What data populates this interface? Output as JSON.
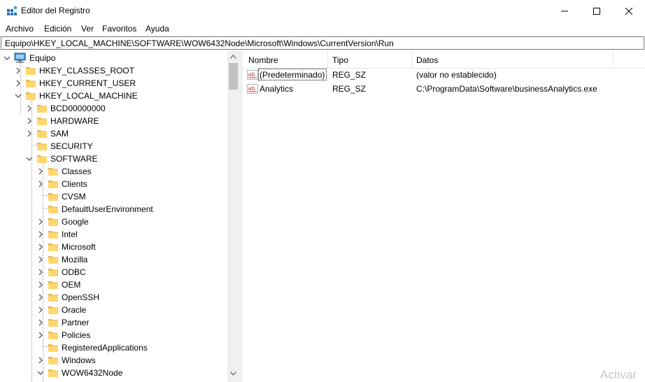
{
  "window": {
    "title": "Editor del Registro",
    "icon": "registry-editor-icon"
  },
  "menu": {
    "items": [
      "Archivo",
      "Edición",
      "Ver",
      "Favoritos",
      "Ayuda"
    ]
  },
  "address": {
    "path": "Equipo\\HKEY_LOCAL_MACHINE\\SOFTWARE\\WOW6432Node\\Microsoft\\Windows\\CurrentVersion\\Run"
  },
  "tree": {
    "root": "Equipo",
    "nodes": [
      {
        "label": "HKEY_CLASSES_ROOT",
        "state": "collapsed"
      },
      {
        "label": "HKEY_CURRENT_USER",
        "state": "collapsed"
      },
      {
        "label": "HKEY_LOCAL_MACHINE",
        "state": "expanded"
      },
      {
        "label": "BCD00000000",
        "state": "collapsed"
      },
      {
        "label": "HARDWARE",
        "state": "collapsed"
      },
      {
        "label": "SAM",
        "state": "collapsed"
      },
      {
        "label": "SECURITY",
        "state": "leaf"
      },
      {
        "label": "SOFTWARE",
        "state": "expanded"
      },
      {
        "label": "Classes",
        "state": "collapsed"
      },
      {
        "label": "Clients",
        "state": "collapsed"
      },
      {
        "label": "CVSM",
        "state": "leaf"
      },
      {
        "label": "DefaultUserEnvironment",
        "state": "leaf"
      },
      {
        "label": "Google",
        "state": "collapsed"
      },
      {
        "label": "Intel",
        "state": "collapsed"
      },
      {
        "label": "Microsoft",
        "state": "collapsed"
      },
      {
        "label": "Mozilla",
        "state": "collapsed"
      },
      {
        "label": "ODBC",
        "state": "collapsed"
      },
      {
        "label": "OEM",
        "state": "collapsed"
      },
      {
        "label": "OpenSSH",
        "state": "collapsed"
      },
      {
        "label": "Oracle",
        "state": "collapsed"
      },
      {
        "label": "Partner",
        "state": "collapsed"
      },
      {
        "label": "Policies",
        "state": "collapsed"
      },
      {
        "label": "RegisteredApplications",
        "state": "leaf"
      },
      {
        "label": "Windows",
        "state": "collapsed"
      },
      {
        "label": "WOW6432Node",
        "state": "expanded"
      }
    ]
  },
  "list": {
    "columns": [
      "Nombre",
      "Tipo",
      "Datos"
    ],
    "rows": [
      {
        "name": "(Predeterminado)",
        "type": "REG_SZ",
        "data": "(valor no establecido)",
        "icon": "string-value-icon"
      },
      {
        "name": "Analytics",
        "type": "REG_SZ",
        "data": "C:\\ProgramData\\Software\\businessAnalytics.exe",
        "icon": "string-value-icon"
      }
    ]
  },
  "watermark": "Activar",
  "colors": {
    "folder": "#ffd76e",
    "folder_dark": "#e8b84a",
    "value_icon": "#c0392b",
    "scroll_thumb": "#c1c1c1"
  }
}
